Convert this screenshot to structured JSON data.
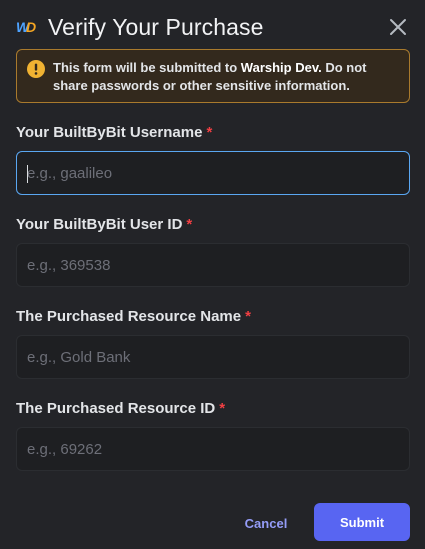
{
  "modal": {
    "title": "Verify Your Purchase",
    "app_icon": "warship-dev-logo-icon",
    "close_icon": "close-icon"
  },
  "notice": {
    "icon": "warning-icon",
    "text_before": "This form will be submitted to ",
    "text_strong": "Warship Dev.",
    "text_after": " Do not share passwords or other sensitive information.",
    "border_color": "#a97a2d",
    "icon_color": "#f0b232"
  },
  "fields": [
    {
      "label": "Your BuiltByBit Username",
      "required_mark": "*",
      "placeholder": "e.g., gaalileo",
      "value": ""
    },
    {
      "label": "Your BuiltByBit User ID",
      "required_mark": "*",
      "placeholder": "e.g., 369538",
      "value": ""
    },
    {
      "label": "The Purchased Resource Name",
      "required_mark": "*",
      "placeholder": "e.g., Gold Bank",
      "value": ""
    },
    {
      "label": "The Purchased Resource ID",
      "required_mark": "*",
      "placeholder": "e.g., 69262",
      "value": ""
    }
  ],
  "actions": {
    "cancel_label": "Cancel",
    "submit_label": "Submit",
    "submit_color": "#5865f2"
  }
}
